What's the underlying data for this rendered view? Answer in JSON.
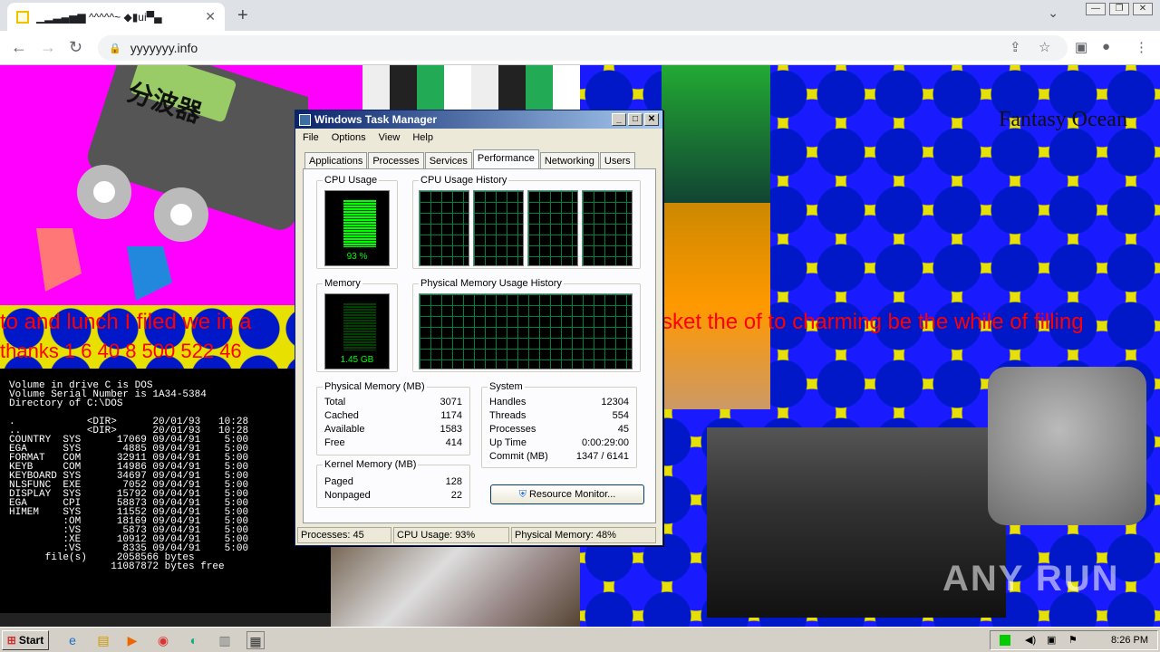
{
  "browser": {
    "tab_title": "▁▂▃▄▅▆ ^^^^^~ ◆▮ui▀▄",
    "tab_close": "✕",
    "new_tab": "+",
    "url": "yyyyyyy.info",
    "window_controls": [
      "—",
      "❐",
      "✕"
    ]
  },
  "page": {
    "splitter_sign": "分波器",
    "red_text_1": "to and lunch I filed we in a",
    "red_text_2": "thanks 1 6 40 8 500 522 46",
    "red_text_3": "sket the of to charming be the while of filling",
    "fantasy_label": "Fantasy Ocean",
    "dos_listing": "Volume in drive C is DOS\nVolume Serial Number is 1A34-5384\nDirectory of C:\\DOS\n\n.            <DIR>      20/01/93   10:28\n..           <DIR>      20/01/93   10:28\nCOUNTRY  SYS      17069 09/04/91    5:00\nEGA      SYS       4885 09/04/91    5:00\nFORMAT   COM      32911 09/04/91    5:00\nKEYB     COM      14986 09/04/91    5:00\nKEYBOARD SYS      34697 09/04/91    5:00\nNLSFUNC  EXE       7052 09/04/91    5:00\nDISPLAY  SYS      15792 09/04/91    5:00\nEGA      CPI      58873 09/04/91    5:00\nHIMEM    SYS      11552 09/04/91    5:00\n         :OM      18169 09/04/91    5:00\n         :VS       5873 09/04/91    5:00\n         :XE      10912 09/04/91    5:00\n         :VS       8335 09/04/91    5:00\n      file(s)     2058566 bytes\n                 11087872 bytes free",
    "watermark": "ANY RUN"
  },
  "taskmgr": {
    "title": "Windows Task Manager",
    "menu": [
      "File",
      "Options",
      "View",
      "Help"
    ],
    "tabs": [
      "Applications",
      "Processes",
      "Services",
      "Performance",
      "Networking",
      "Users"
    ],
    "active_tab": "Performance",
    "cpu_usage_label": "CPU Usage",
    "cpu_usage_value": "93 %",
    "cpu_history_label": "CPU Usage History",
    "memory_label": "Memory",
    "memory_value": "1.45 GB",
    "phys_history_label": "Physical Memory Usage History",
    "physical_memory": {
      "label": "Physical Memory (MB)",
      "rows": [
        [
          "Total",
          "3071"
        ],
        [
          "Cached",
          "1174"
        ],
        [
          "Available",
          "1583"
        ],
        [
          "Free",
          "414"
        ]
      ]
    },
    "kernel_memory": {
      "label": "Kernel Memory (MB)",
      "rows": [
        [
          "Paged",
          "128"
        ],
        [
          "Nonpaged",
          "22"
        ]
      ]
    },
    "system": {
      "label": "System",
      "rows": [
        [
          "Handles",
          "12304"
        ],
        [
          "Threads",
          "554"
        ],
        [
          "Processes",
          "45"
        ],
        [
          "Up Time",
          "0:00:29:00"
        ],
        [
          "Commit (MB)",
          "1347 / 6141"
        ]
      ]
    },
    "resource_monitor_button": "Resource Monitor...",
    "status": {
      "processes": "Processes: 45",
      "cpu": "CPU Usage: 93%",
      "memory": "Physical Memory: 48%"
    }
  },
  "taskbar": {
    "start_label": "Start",
    "clock": "8:26 PM"
  },
  "colors": {
    "graph_green": "#00ff00",
    "xp_title": "#0a246a",
    "magenta_bg": "#ff00ff",
    "yellow_bg": "#e8e000",
    "blue_circle": "#0018c8"
  }
}
